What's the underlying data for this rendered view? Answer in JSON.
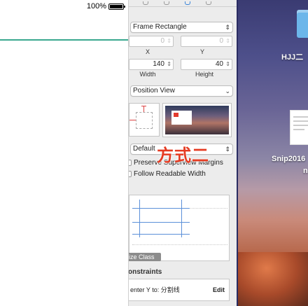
{
  "simulator": {
    "battery_text": "100%"
  },
  "inspector": {
    "frame_popup": "Frame Rectangle",
    "x_label": "X",
    "y_label": "Y",
    "x_value": "0",
    "y_value": "0",
    "width_value": "140",
    "height_value": "40",
    "width_label": "Width",
    "height_label": "Height",
    "arrange_popup": "Position View",
    "layout_popup": "Default",
    "preserve_margins": "Preserve Superview Margins",
    "follow_readable": "Follow Readable Width",
    "size_class_tag": "ize Class",
    "constraints_title": "onstraints",
    "constraint_text": "enter Y to: 分割线",
    "constraint_edit": "Edit",
    "overlay_text": "方式二"
  },
  "desktop": {
    "folder_label": "HJJ二",
    "snip_label": "Snip2016",
    "snip_label_2": "n"
  },
  "colors": {
    "divider": "#3aa88f",
    "accent": "#3b84d8",
    "overlay": "#e53b22"
  }
}
